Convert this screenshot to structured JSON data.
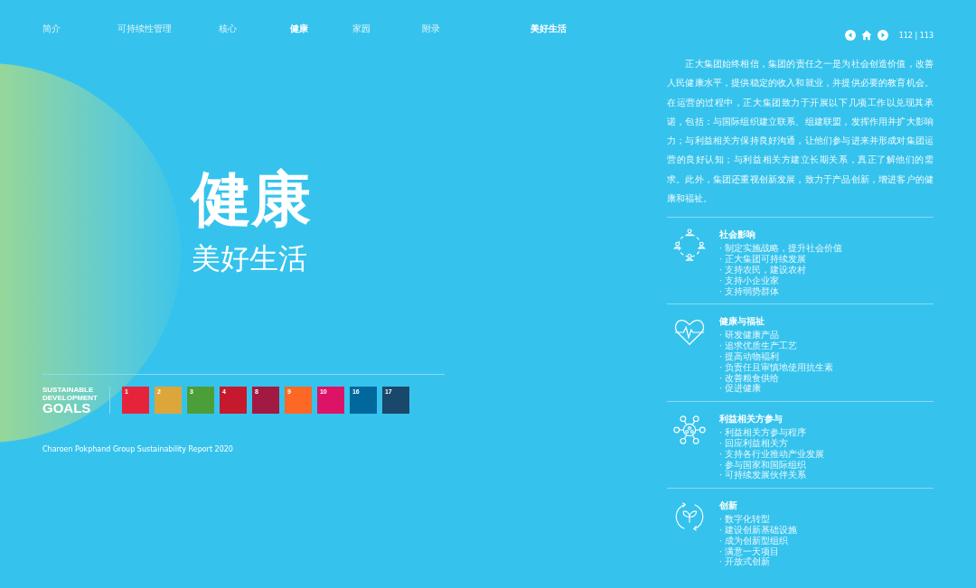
{
  "nav": [
    {
      "label": "简介",
      "selected": false
    },
    {
      "label": "可持续性管理",
      "selected": false
    },
    {
      "label": "核心",
      "selected": false
    },
    {
      "label": "健康",
      "selected": true
    },
    {
      "label": "家园",
      "selected": false
    },
    {
      "label": "附录",
      "selected": false
    }
  ],
  "section_label": "美好生活",
  "page_numbers": "112 | 113",
  "title": "健康",
  "subtitle": "美好生活",
  "intro": "正大集团始终相信，集团的责任之一是为社会创造价值，改善人民健康水平，提供稳定的收入和就业，并提供必要的教育机会。在运营的过程中，正大集团致力于开展以下几项工作以兑现其承诺，包括：与国际组织建立联系、组建联盟，发挥作用并扩大影响力；与利益相关方保持良好沟通，让他们参与进来并形成对集团运营的良好认知；与利益相关方建立长期关系，真正了解他们的需求。此外，集团还重视创新发展，致力于产品创新，增进客户的健康和福祉。",
  "sections": [
    {
      "kind": "community",
      "title": "社会影响",
      "items": [
        "· 制定实施战略，提升社会价值",
        "· 正大集团可持续发展",
        "· 支持农民，建设农村",
        "· 支持小企业家",
        "· 支持弱势群体"
      ]
    },
    {
      "kind": "heart",
      "title": "健康与福祉",
      "items": [
        "· 研发健康产品",
        "· 追求优质生产工艺",
        "· 提高动物福利",
        "· 负责任且审慎地使用抗生素",
        "· 改善粮食供给",
        "· 促进健康"
      ]
    },
    {
      "kind": "network",
      "title": "利益相关方参与",
      "items": [
        "· 利益相关方参与程序",
        "· 回应利益相关方",
        "· 支持各行业推动产业发展",
        "· 参与国家和国际组织",
        "· 可持续发展伙伴关系"
      ]
    },
    {
      "kind": "cycle",
      "title": "创新",
      "items": [
        "· 数字化转型",
        "· 建设创新基础设施",
        "· 成为创新型组织",
        "· 满意一天项目",
        "· 开放式创新"
      ]
    }
  ],
  "sdg_logo": [
    "SUSTAINABLE",
    "DEVELOPMENT",
    "GOALS"
  ],
  "sdg_goals": [
    {
      "number": "1",
      "color": "#e5243b"
    },
    {
      "number": "2",
      "color": "#dda63a"
    },
    {
      "number": "3",
      "color": "#4c9f38"
    },
    {
      "number": "4",
      "color": "#c5192d"
    },
    {
      "number": "8",
      "color": "#a21942"
    },
    {
      "number": "9",
      "color": "#fd6925"
    },
    {
      "number": "10",
      "color": "#dd1367"
    },
    {
      "number": "16",
      "color": "#00689d"
    },
    {
      "number": "17",
      "color": "#19486a"
    }
  ],
  "footer": "Charoen Pokphand Group Sustainability Report 2020"
}
